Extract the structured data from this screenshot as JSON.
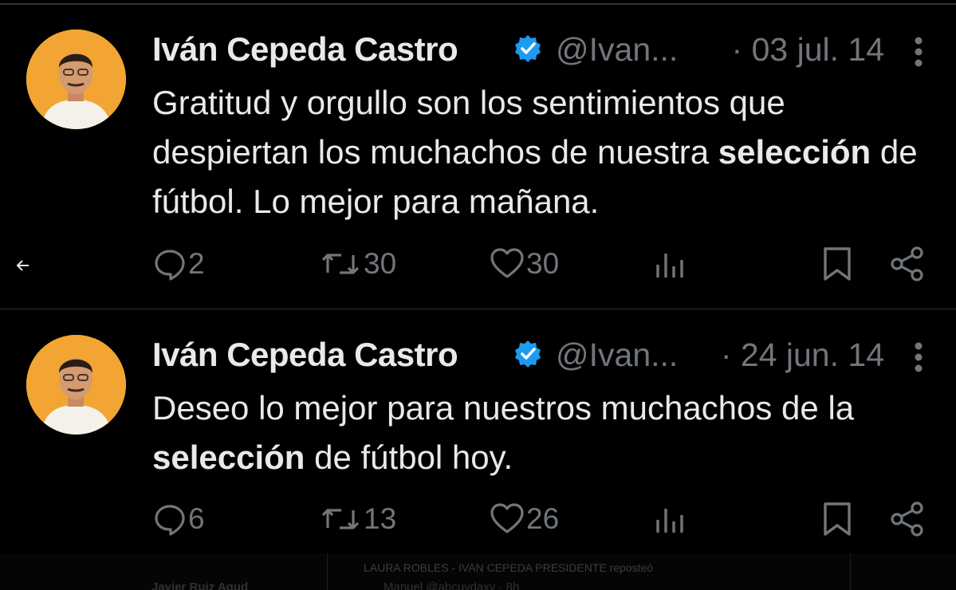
{
  "tweets": [
    {
      "name": "Iván Cepeda Castro",
      "handle": "@Ivan...",
      "date": "· 03 jul. 14",
      "text_before": "Gratitud y orgullo son los sentimientos que despiertan los muchachos de nuestra ",
      "text_bold": "selección",
      "text_after": " de fútbol. Lo mejor para mañana.",
      "replies": "2",
      "reposts": "30",
      "likes": "30"
    },
    {
      "name": "Iván Cepeda Castro",
      "handle": "@Ivan...",
      "date": "· 24 jun. 14",
      "text_before": "Deseo lo mejor para nuestros muchachos de la ",
      "text_bold": "selección",
      "text_after": " de fútbol hoy.",
      "replies": "6",
      "reposts": "13",
      "likes": "26"
    }
  ],
  "background_strip": {
    "repost_text": "LAURA ROBLES - IVAN CEPEDA PRESIDENTE reposteó",
    "left_name": "Javier Ruiz Agud",
    "user": "Manuel @abcuvdaxy · 8h"
  },
  "colors": {
    "background": "#000000",
    "text": "#e7e9ea",
    "muted": "#71767b",
    "verified": "#1d9bf0",
    "avatar_bg": "#f3a533"
  },
  "icons": [
    "back-arrow-icon",
    "verified-badge-icon",
    "more-icon",
    "reply-icon",
    "repost-icon",
    "like-icon",
    "views-icon",
    "bookmark-icon",
    "share-icon"
  ]
}
